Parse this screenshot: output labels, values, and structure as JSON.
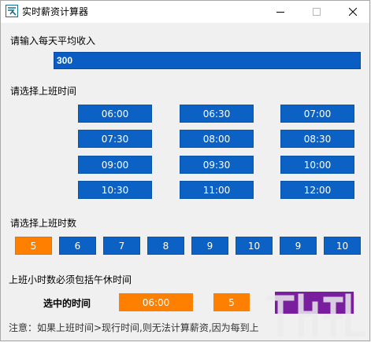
{
  "window": {
    "title": "实时薪资计算器"
  },
  "income": {
    "label": "请输入每天平均收入",
    "value": "300"
  },
  "start_time": {
    "label": "请选择上班时间",
    "options": [
      "06:00",
      "06:30",
      "07:00",
      "07:30",
      "08:00",
      "08:30",
      "09:00",
      "09:30",
      "10:00",
      "10:30",
      "11:00",
      "12:00"
    ]
  },
  "hours": {
    "label": "请选择上班时数",
    "options": [
      "5",
      "6",
      "7",
      "8",
      "9",
      "10",
      "9",
      "10"
    ],
    "selected_index": 0
  },
  "hours_note": "上班小时数必须包括午休时间",
  "summary": {
    "label": "选中的时间",
    "time": "06:00",
    "hours": "5"
  },
  "note": "注意：如果上班时间>现行时间,则无法计算薪资,因为每到上",
  "colors": {
    "button_blue": "#0b62c4",
    "selected_orange": "#ff8000",
    "purple": "#7a1ea0"
  },
  "icons": {
    "app": "app-logo-icon",
    "minimize": "minimize-icon",
    "maximize": "maximize-icon",
    "close": "close-icon"
  }
}
